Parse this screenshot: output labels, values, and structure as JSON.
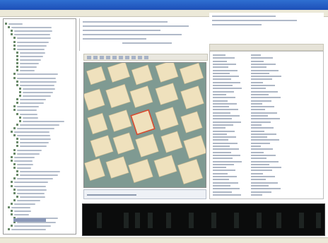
{
  "window": {
    "title": ""
  },
  "menubar": {
    "items": [
      "",
      "",
      "",
      ""
    ]
  },
  "colors": {
    "map_background": "#7f9a92",
    "building_fill": "#efe1bd",
    "selection_outline": "#d84a2f",
    "console_background": "#0b0c0c",
    "titlebar": "#1d4fb8"
  }
}
